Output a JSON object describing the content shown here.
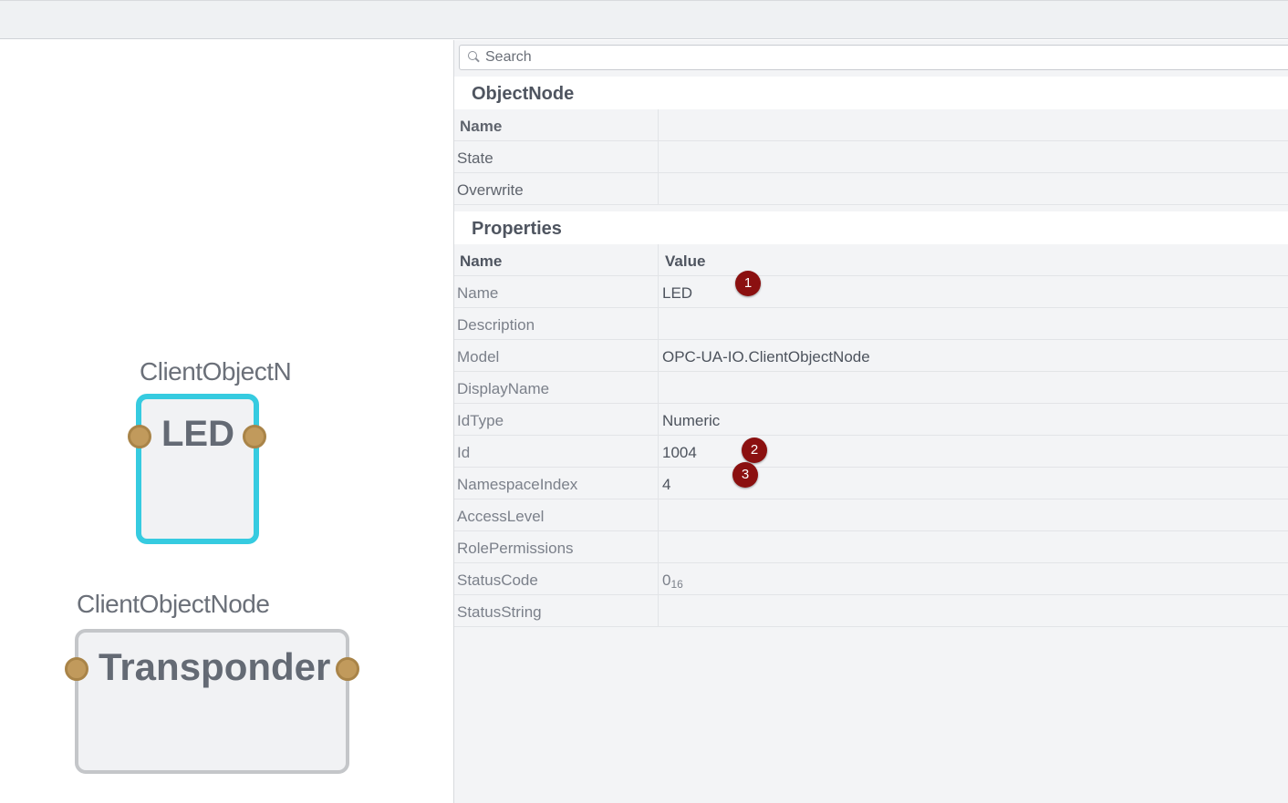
{
  "canvas": {
    "nodes": [
      {
        "caption": "ClientObjectN",
        "title": "LED",
        "selected": true
      },
      {
        "caption": "ClientObjectNode",
        "title": "Transponder",
        "selected": false
      }
    ]
  },
  "panel": {
    "search": {
      "placeholder": "Search"
    },
    "object_section": {
      "title": "ObjectNode",
      "rows": [
        "Name",
        "State",
        "Overwrite"
      ]
    },
    "properties_section": {
      "title": "Properties",
      "header": {
        "name": "Name",
        "value": "Value"
      },
      "rows": [
        {
          "name": "Name",
          "value": "LED"
        },
        {
          "name": "Description",
          "value": ""
        },
        {
          "name": "Model",
          "value": "OPC-UA-IO.ClientObjectNode"
        },
        {
          "name": "DisplayName",
          "value": ""
        },
        {
          "name": "IdType",
          "value": "Numeric"
        },
        {
          "name": "Id",
          "value": "1004"
        },
        {
          "name": "NamespaceIndex",
          "value": "4"
        },
        {
          "name": "AccessLevel",
          "value": ""
        },
        {
          "name": "RolePermissions",
          "value": ""
        },
        {
          "name": "StatusCode",
          "value": "0",
          "value_sub": "16"
        },
        {
          "name": "StatusString",
          "value": ""
        }
      ]
    },
    "markers": [
      "1",
      "2",
      "3"
    ]
  },
  "colors": {
    "selected_border": "#36cbe0",
    "unselected_border": "#c4c6c9",
    "port": "#c19a5c",
    "marker": "#8b1010"
  }
}
